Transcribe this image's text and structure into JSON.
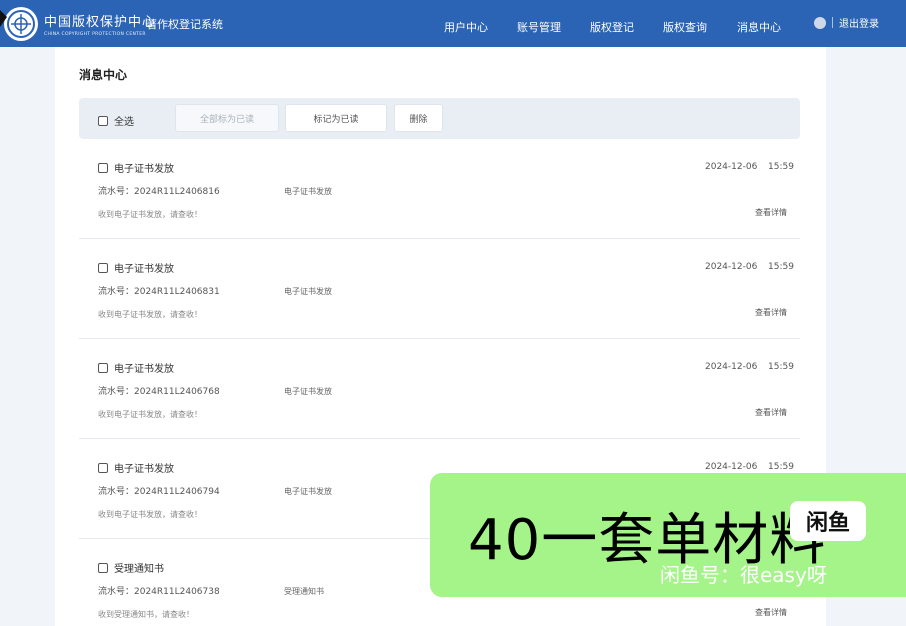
{
  "header": {
    "logo_cn": "中国版权保护中心",
    "logo_en": "CHINA COPYRIGHT PROTECTION CENTER",
    "system_name": "著作权登记系统",
    "nav": [
      "用户中心",
      "账号管理",
      "版权登记",
      "版权查询",
      "消息中心"
    ],
    "logout": "退出登录"
  },
  "page": {
    "title": "消息中心"
  },
  "toolbar": {
    "select_all": "全选",
    "mark_all_read": "全部标为已读",
    "mark_read": "标记为已读",
    "delete": "删除"
  },
  "messages": [
    {
      "title": "电子证书发放",
      "serial": "流水号：2024R11L2406816",
      "type": "电子证书发放",
      "desc": "收到电子证书发放，请查收！",
      "date": "2024-12-06",
      "time": "15:59",
      "detail": "查看详情"
    },
    {
      "title": "电子证书发放",
      "serial": "流水号：2024R11L2406831",
      "type": "电子证书发放",
      "desc": "收到电子证书发放，请查收！",
      "date": "2024-12-06",
      "time": "15:59",
      "detail": "查看详情"
    },
    {
      "title": "电子证书发放",
      "serial": "流水号：2024R11L2406768",
      "type": "电子证书发放",
      "desc": "收到电子证书发放，请查收！",
      "date": "2024-12-06",
      "time": "15:59",
      "detail": "查看详情"
    },
    {
      "title": "电子证书发放",
      "serial": "流水号：2024R11L2406794",
      "type": "电子证书发放",
      "desc": "收到电子证书发放，请查收！",
      "date": "2024-12-06",
      "time": "15:59",
      "detail": ""
    },
    {
      "title": "受理通知书",
      "serial": "流水号：2024R11L2406738",
      "type": "受理通知书",
      "desc": "收到受理通知书，请查收！",
      "date": "",
      "time": "",
      "detail": "查看详情"
    }
  ],
  "overlay": {
    "headline": "40一套单材料",
    "badge": "闲鱼",
    "sub": "闲鱼号：很easy呀"
  },
  "colors": {
    "header_bg": "#2b63b5",
    "overlay_bg": "#a5f48a"
  }
}
